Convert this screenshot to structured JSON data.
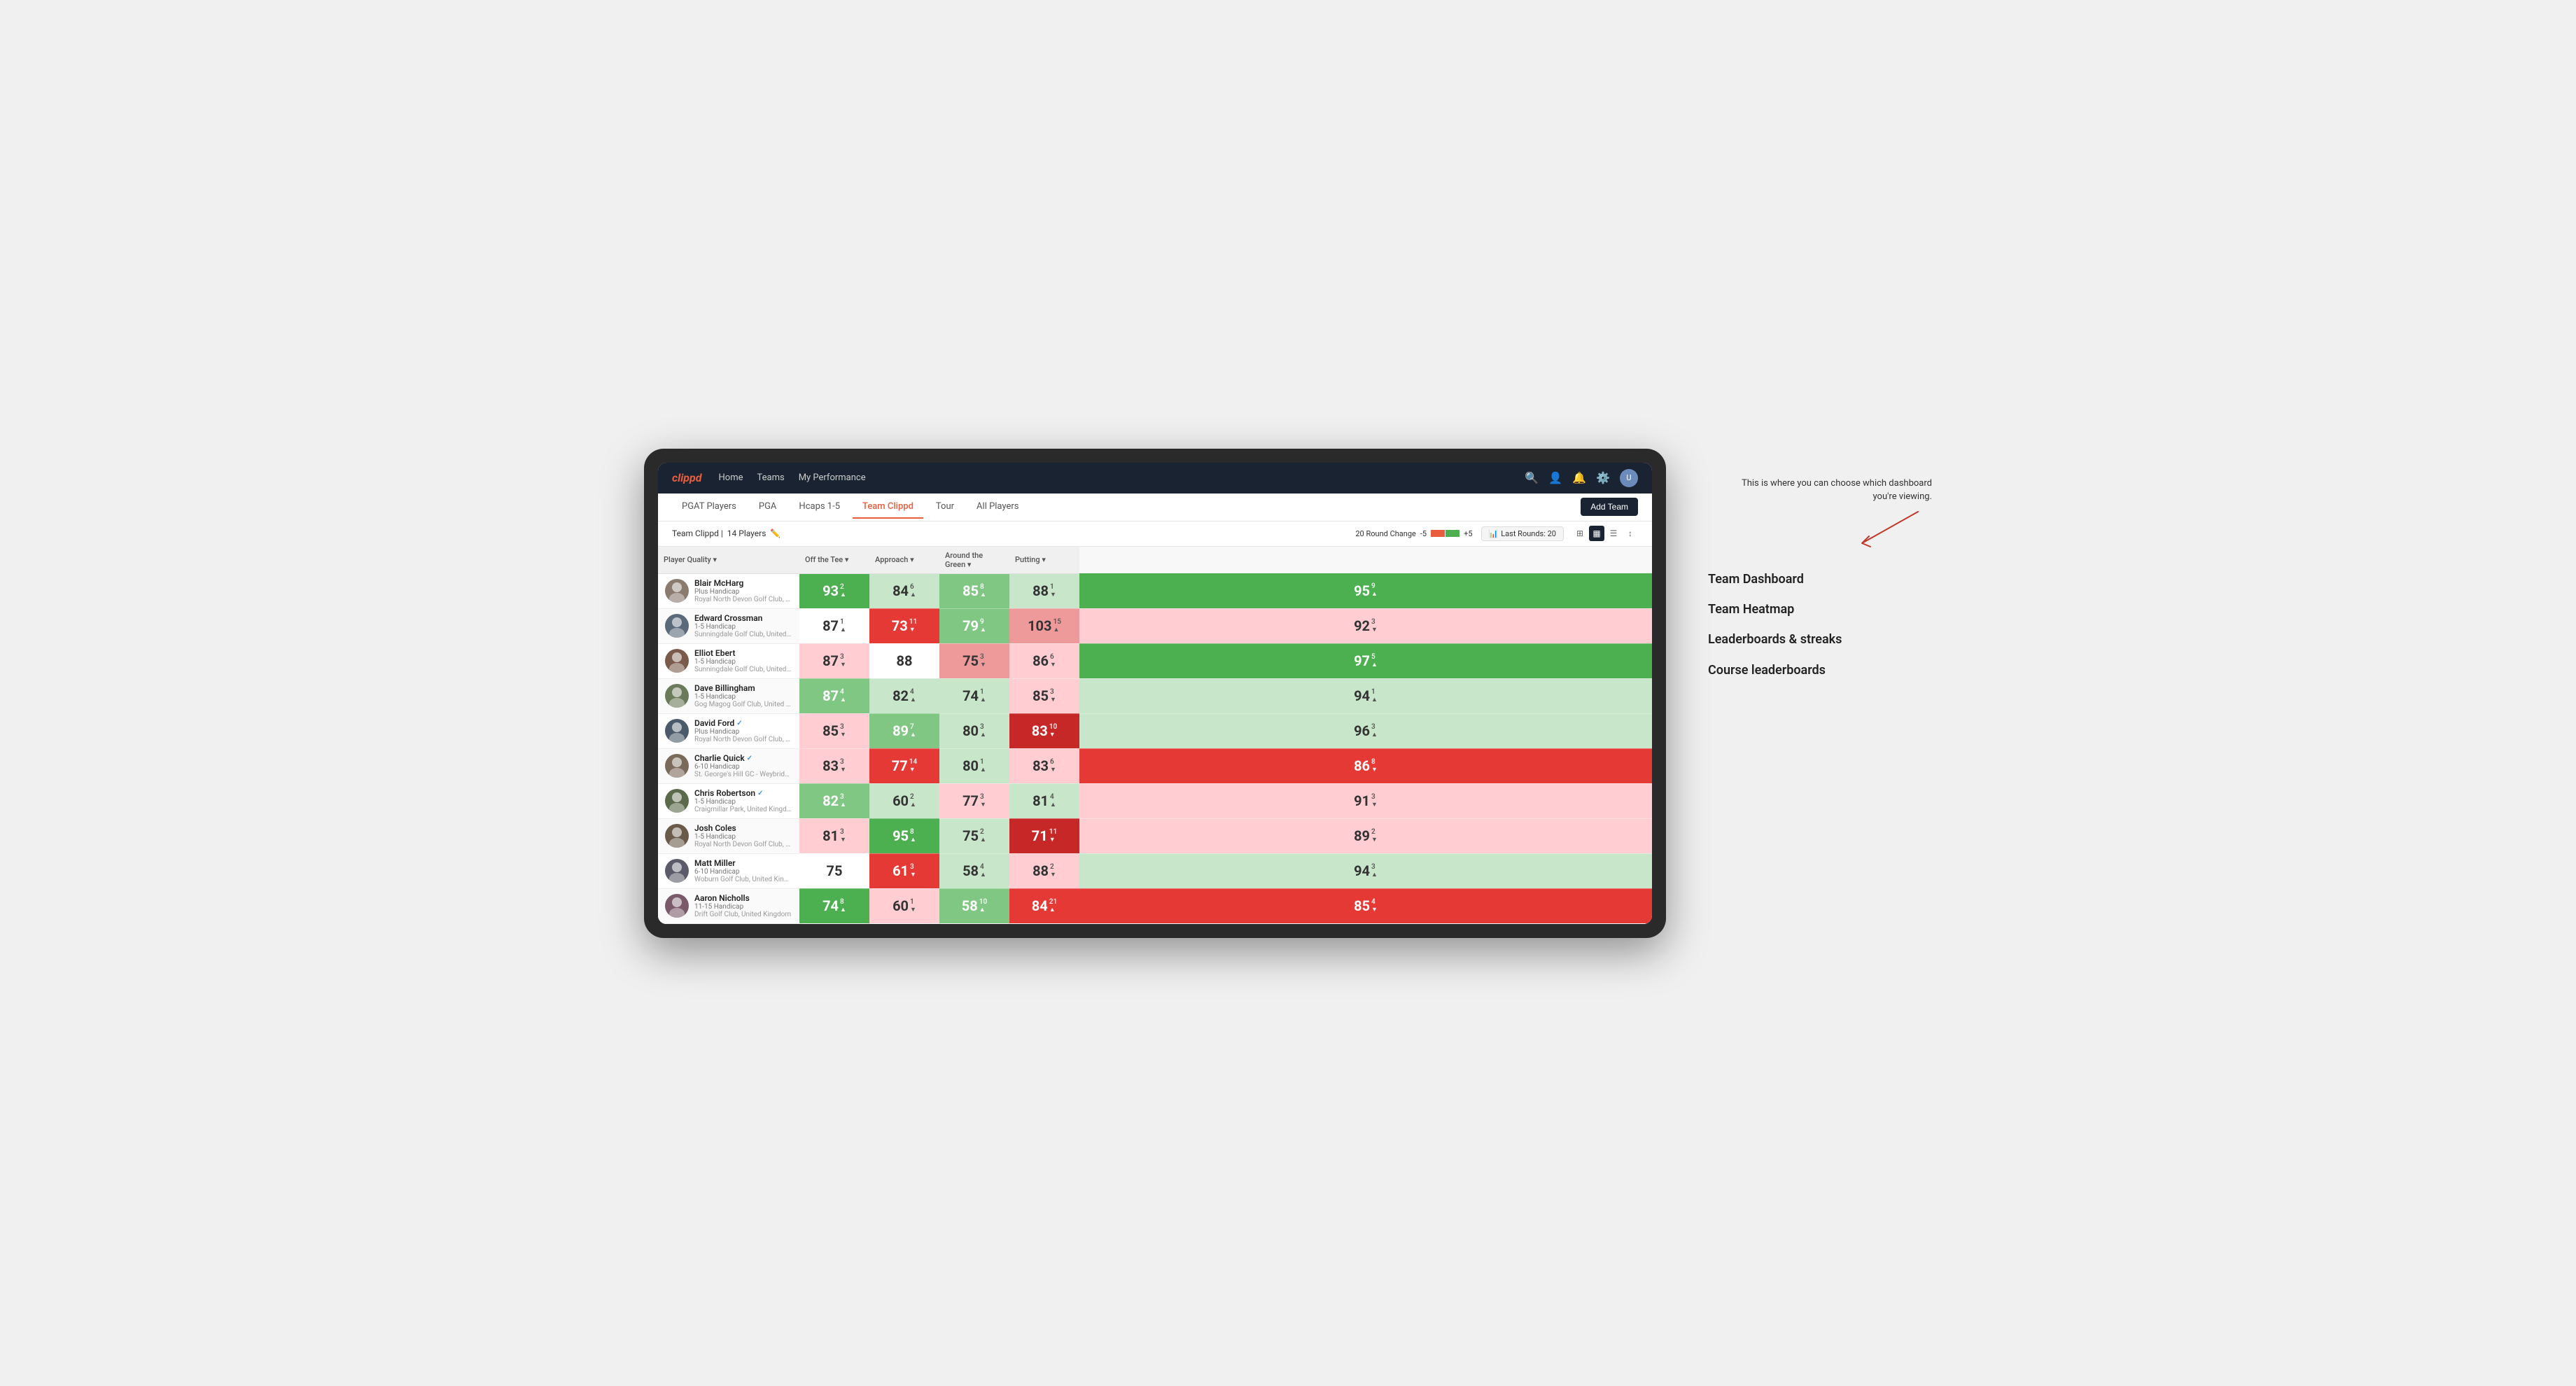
{
  "nav": {
    "logo": "clippd",
    "links": [
      "Home",
      "Teams",
      "My Performance"
    ],
    "icons": [
      "search",
      "person",
      "bell",
      "settings",
      "avatar"
    ]
  },
  "tabs": {
    "items": [
      "PGAT Players",
      "PGA",
      "Hcaps 1-5",
      "Team Clippd",
      "Tour",
      "All Players"
    ],
    "active": "Team Clippd",
    "add_button": "Add Team"
  },
  "subheader": {
    "team_name": "Team Clippd",
    "player_count": "14 Players",
    "round_change_label": "20 Round Change",
    "change_min": "-5",
    "change_max": "+5",
    "last_rounds_label": "Last Rounds:",
    "last_rounds_value": "20"
  },
  "columns": {
    "player": "Player Quality",
    "off_tee": "Off the Tee",
    "approach": "Approach",
    "around_green": "Around the Green",
    "putting": "Putting"
  },
  "players": [
    {
      "name": "Blair McHarg",
      "handicap": "Plus Handicap",
      "club": "Royal North Devon Golf Club, United Kingdom",
      "verified": false,
      "avatar_color": "#8a7b6e",
      "scores": {
        "quality": {
          "value": 93,
          "change": 2,
          "dir": "up",
          "bg": "bg-green-medium"
        },
        "off_tee": {
          "value": 84,
          "change": 6,
          "dir": "up",
          "bg": "bg-green-pale"
        },
        "approach": {
          "value": 85,
          "change": 8,
          "dir": "up",
          "bg": "bg-green-light"
        },
        "around_green": {
          "value": 88,
          "change": 1,
          "dir": "down",
          "bg": "bg-green-pale"
        },
        "putting": {
          "value": 95,
          "change": 9,
          "dir": "up",
          "bg": "bg-green-medium"
        }
      }
    },
    {
      "name": "Edward Crossman",
      "handicap": "1-5 Handicap",
      "club": "Sunningdale Golf Club, United Kingdom",
      "verified": false,
      "avatar_color": "#5a6a7a",
      "scores": {
        "quality": {
          "value": 87,
          "change": 1,
          "dir": "up",
          "bg": "bg-white"
        },
        "off_tee": {
          "value": 73,
          "change": 11,
          "dir": "down",
          "bg": "bg-red-medium"
        },
        "approach": {
          "value": 79,
          "change": 9,
          "dir": "up",
          "bg": "bg-green-light"
        },
        "around_green": {
          "value": 103,
          "change": 15,
          "dir": "up",
          "bg": "bg-red-light"
        },
        "putting": {
          "value": 92,
          "change": 3,
          "dir": "down",
          "bg": "bg-red-pale"
        }
      }
    },
    {
      "name": "Elliot Ebert",
      "handicap": "1-5 Handicap",
      "club": "Sunningdale Golf Club, United Kingdom",
      "verified": false,
      "avatar_color": "#7a5a4a",
      "scores": {
        "quality": {
          "value": 87,
          "change": 3,
          "dir": "down",
          "bg": "bg-red-pale"
        },
        "off_tee": {
          "value": 88,
          "change": 0,
          "dir": null,
          "bg": "bg-white"
        },
        "approach": {
          "value": 75,
          "change": 3,
          "dir": "down",
          "bg": "bg-red-light"
        },
        "around_green": {
          "value": 86,
          "change": 6,
          "dir": "down",
          "bg": "bg-red-pale"
        },
        "putting": {
          "value": 97,
          "change": 5,
          "dir": "up",
          "bg": "bg-green-medium"
        }
      }
    },
    {
      "name": "Dave Billingham",
      "handicap": "1-5 Handicap",
      "club": "Gog Magog Golf Club, United Kingdom",
      "verified": false,
      "avatar_color": "#6a7a5a",
      "scores": {
        "quality": {
          "value": 87,
          "change": 4,
          "dir": "up",
          "bg": "bg-green-light"
        },
        "off_tee": {
          "value": 82,
          "change": 4,
          "dir": "up",
          "bg": "bg-green-pale"
        },
        "approach": {
          "value": 74,
          "change": 1,
          "dir": "up",
          "bg": "bg-green-pale"
        },
        "around_green": {
          "value": 85,
          "change": 3,
          "dir": "down",
          "bg": "bg-red-pale"
        },
        "putting": {
          "value": 94,
          "change": 1,
          "dir": "up",
          "bg": "bg-green-pale"
        }
      }
    },
    {
      "name": "David Ford",
      "handicap": "Plus Handicap",
      "club": "Royal North Devon Golf Club, United Kingdom",
      "verified": true,
      "avatar_color": "#4a5a6a",
      "scores": {
        "quality": {
          "value": 85,
          "change": 3,
          "dir": "down",
          "bg": "bg-red-pale"
        },
        "off_tee": {
          "value": 89,
          "change": 7,
          "dir": "up",
          "bg": "bg-green-light"
        },
        "approach": {
          "value": 80,
          "change": 3,
          "dir": "up",
          "bg": "bg-green-pale"
        },
        "around_green": {
          "value": 83,
          "change": 10,
          "dir": "down",
          "bg": "bg-red-dark"
        },
        "putting": {
          "value": 96,
          "change": 3,
          "dir": "up",
          "bg": "bg-green-pale"
        }
      }
    },
    {
      "name": "Charlie Quick",
      "handicap": "6-10 Handicap",
      "club": "St. George's Hill GC - Weybridge - Surrey, Uni...",
      "verified": true,
      "avatar_color": "#7a6a5a",
      "scores": {
        "quality": {
          "value": 83,
          "change": 3,
          "dir": "down",
          "bg": "bg-red-pale"
        },
        "off_tee": {
          "value": 77,
          "change": 14,
          "dir": "down",
          "bg": "bg-red-medium"
        },
        "approach": {
          "value": 80,
          "change": 1,
          "dir": "up",
          "bg": "bg-green-pale"
        },
        "around_green": {
          "value": 83,
          "change": 6,
          "dir": "down",
          "bg": "bg-red-pale"
        },
        "putting": {
          "value": 86,
          "change": 8,
          "dir": "down",
          "bg": "bg-red-medium"
        }
      }
    },
    {
      "name": "Chris Robertson",
      "handicap": "1-5 Handicap",
      "club": "Craigmillar Park, United Kingdom",
      "verified": true,
      "avatar_color": "#5a6a4a",
      "scores": {
        "quality": {
          "value": 82,
          "change": 3,
          "dir": "up",
          "bg": "bg-green-light"
        },
        "off_tee": {
          "value": 60,
          "change": 2,
          "dir": "up",
          "bg": "bg-green-pale"
        },
        "approach": {
          "value": 77,
          "change": 3,
          "dir": "down",
          "bg": "bg-red-pale"
        },
        "around_green": {
          "value": 81,
          "change": 4,
          "dir": "up",
          "bg": "bg-green-pale"
        },
        "putting": {
          "value": 91,
          "change": 3,
          "dir": "down",
          "bg": "bg-red-pale"
        }
      }
    },
    {
      "name": "Josh Coles",
      "handicap": "1-5 Handicap",
      "club": "Royal North Devon Golf Club, United Kingdom",
      "verified": false,
      "avatar_color": "#6a5a4a",
      "scores": {
        "quality": {
          "value": 81,
          "change": 3,
          "dir": "down",
          "bg": "bg-red-pale"
        },
        "off_tee": {
          "value": 95,
          "change": 8,
          "dir": "up",
          "bg": "bg-green-medium"
        },
        "approach": {
          "value": 75,
          "change": 2,
          "dir": "up",
          "bg": "bg-green-pale"
        },
        "around_green": {
          "value": 71,
          "change": 11,
          "dir": "down",
          "bg": "bg-red-dark"
        },
        "putting": {
          "value": 89,
          "change": 2,
          "dir": "down",
          "bg": "bg-red-pale"
        }
      }
    },
    {
      "name": "Matt Miller",
      "handicap": "6-10 Handicap",
      "club": "Woburn Golf Club, United Kingdom",
      "verified": false,
      "avatar_color": "#5a5a6a",
      "scores": {
        "quality": {
          "value": 75,
          "change": 0,
          "dir": null,
          "bg": "bg-white"
        },
        "off_tee": {
          "value": 61,
          "change": 3,
          "dir": "down",
          "bg": "bg-red-medium"
        },
        "approach": {
          "value": 58,
          "change": 4,
          "dir": "up",
          "bg": "bg-green-pale"
        },
        "around_green": {
          "value": 88,
          "change": 2,
          "dir": "down",
          "bg": "bg-red-pale"
        },
        "putting": {
          "value": 94,
          "change": 3,
          "dir": "up",
          "bg": "bg-green-pale"
        }
      }
    },
    {
      "name": "Aaron Nicholls",
      "handicap": "11-15 Handicap",
      "club": "Drift Golf Club, United Kingdom",
      "verified": false,
      "avatar_color": "#7a5a6a",
      "scores": {
        "quality": {
          "value": 74,
          "change": 8,
          "dir": "up",
          "bg": "bg-green-medium"
        },
        "off_tee": {
          "value": 60,
          "change": 1,
          "dir": "down",
          "bg": "bg-red-pale"
        },
        "approach": {
          "value": 58,
          "change": 10,
          "dir": "up",
          "bg": "bg-green-light"
        },
        "around_green": {
          "value": 84,
          "change": 21,
          "dir": "up",
          "bg": "bg-red-medium"
        },
        "putting": {
          "value": 85,
          "change": 4,
          "dir": "down",
          "bg": "bg-red-medium"
        }
      }
    }
  ],
  "annotation": {
    "intro_text": "This is where you can choose which dashboard you're viewing.",
    "items": [
      "Team Dashboard",
      "Team Heatmap",
      "Leaderboards & streaks",
      "Course leaderboards"
    ]
  }
}
